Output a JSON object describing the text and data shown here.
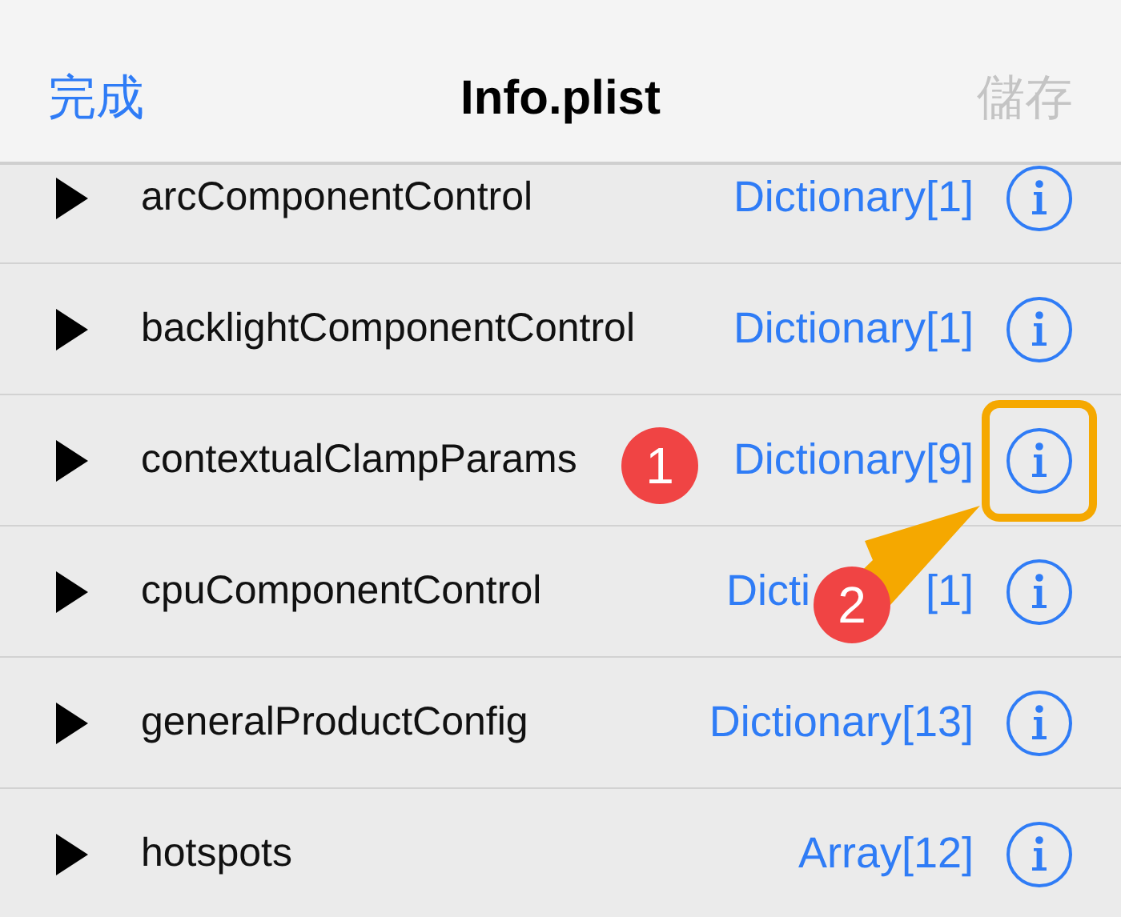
{
  "nav_bar": {
    "left_button": "完成",
    "title": "Info.plist",
    "right_button": {
      "label": "儲存",
      "disabled": true
    }
  },
  "rows": [
    {
      "key": "arcComponentControl",
      "value": "Dictionary[1]",
      "expanded": false,
      "highlighted": false
    },
    {
      "key": "backlightComponentControl",
      "value": "Dictionary[1]",
      "expanded": false,
      "highlighted": false
    },
    {
      "key": "contextualClampParams",
      "value": "Dictionary[9]",
      "expanded": false,
      "highlighted": true
    },
    {
      "key": "cpuComponentControl",
      "value_parts": [
        "Dicti",
        "[1]"
      ],
      "expanded": false,
      "highlighted": false
    },
    {
      "key": "generalProductConfig",
      "value": "Dictionary[13]",
      "expanded": false,
      "highlighted": false
    },
    {
      "key": "hotspots",
      "value": "Array[12]",
      "expanded": false,
      "highlighted": false
    }
  ],
  "annotations": [
    {
      "kind": "badge",
      "text": "1"
    },
    {
      "kind": "badge",
      "text": "2"
    },
    {
      "kind": "arrow"
    }
  ]
}
